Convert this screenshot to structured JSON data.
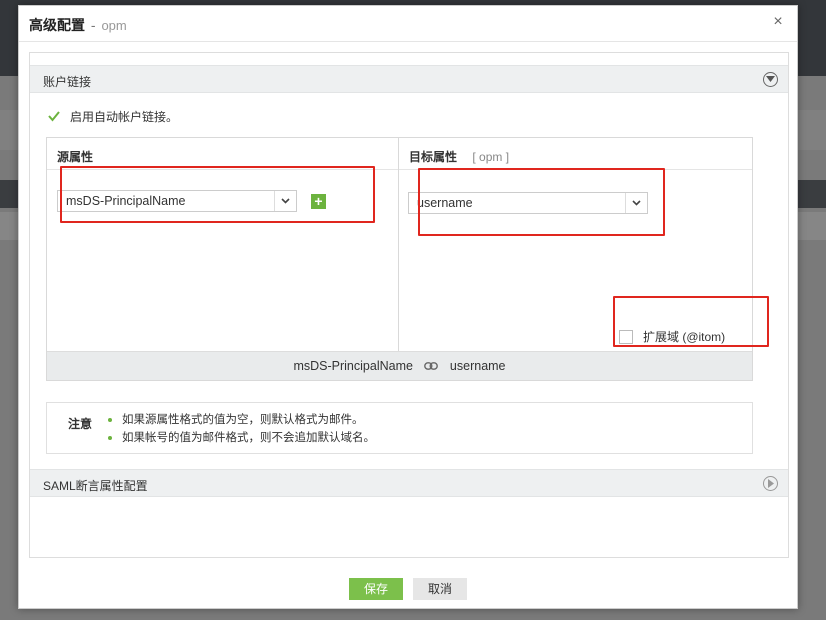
{
  "dialog": {
    "title": "高级配置",
    "separator": "-",
    "subtitle": "opm",
    "close_glyph": "×"
  },
  "account_linking": {
    "section_title": "账户链接",
    "auto_link_label": "启用自动帐户链接。",
    "auto_link_checked": true,
    "source_header": "源属性",
    "target_header": "目标属性",
    "target_app": "[ opm ]",
    "source_value": "msDS-PrincipalName",
    "target_value": "username",
    "add_glyph": "+",
    "extend_domain_label": "扩展域 (@itom)",
    "extend_domain_checked": false,
    "mapping_source": "msDS-PrincipalName",
    "mapping_target": "username"
  },
  "note": {
    "label": "注意",
    "items": [
      "如果源属性格式的值为空，则默认格式为邮件。",
      "如果帐号的值为邮件格式，则不会追加默认域名。"
    ]
  },
  "saml_section": {
    "title": "SAML断言属性配置"
  },
  "footer": {
    "save_label": "保存",
    "cancel_label": "取消"
  },
  "colors": {
    "accent_green": "#7cc04b",
    "highlight_red": "#e0261e"
  }
}
